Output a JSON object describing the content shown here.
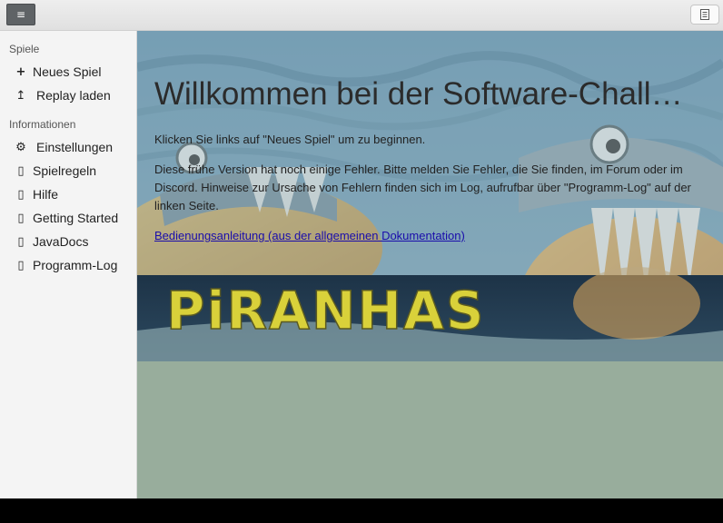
{
  "toolbar": {
    "menu_icon": "hamburger-icon",
    "doc_icon": "document-icon"
  },
  "sidebar": {
    "sections": [
      {
        "title": "Spiele",
        "items": [
          {
            "label": "Neues Spiel",
            "icon": "plus-icon"
          },
          {
            "label": "Replay laden",
            "icon": "upload-icon"
          }
        ]
      },
      {
        "title": "Informationen",
        "items": [
          {
            "label": "Einstellungen",
            "icon": "gear-icon"
          },
          {
            "label": "Spielregeln",
            "icon": "missing-glyph-icon"
          },
          {
            "label": "Hilfe",
            "icon": "missing-glyph-icon"
          },
          {
            "label": "Getting Started",
            "icon": "missing-glyph-icon"
          },
          {
            "label": "JavaDocs",
            "icon": "missing-glyph-icon"
          },
          {
            "label": "Programm-Log",
            "icon": "missing-glyph-icon"
          }
        ]
      }
    ]
  },
  "main": {
    "title": "Willkommen bei der Software-Challenge!",
    "intro": "Klicken Sie links auf \"Neues Spiel\" um zu beginnen.",
    "notice": "Diese frühe Version hat noch einige Fehler. Bitte melden Sie Fehler, die Sie finden, im Forum oder im Discord. Hinweise zur Ursache von Fehlern finden sich im Log, aufrufbar über \"Programm-Log\" auf der linken Seite.",
    "doc_link": "Bedienungsanleitung (aus der allgemeinen Dokumentation)",
    "banner_text": "PiRANHAS"
  },
  "colors": {
    "sidebar_bg": "#f4f4f4",
    "main_bg": "#98ad9c",
    "link": "#1a0dab",
    "banner_text": "#d9d13a"
  }
}
